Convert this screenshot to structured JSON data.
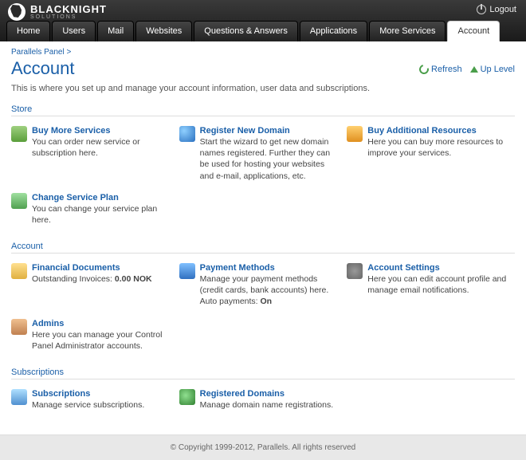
{
  "brand": {
    "name": "BLACKNIGHT",
    "sub": "SOLUTIONS"
  },
  "logout": "Logout",
  "nav": {
    "items": [
      "Home",
      "Users",
      "Mail",
      "Websites",
      "Questions & Answers",
      "Applications",
      "More Services",
      "Account"
    ],
    "active_index": 7
  },
  "breadcrumb": {
    "items": [
      "Parallels Panel"
    ],
    "sep": ">"
  },
  "page": {
    "title": "Account",
    "intro": "This is where you set up and manage your account information, user data and subscriptions."
  },
  "actions": {
    "refresh": "Refresh",
    "uplevel": "Up Level"
  },
  "sections": [
    {
      "title": "Store",
      "cards": [
        {
          "icon": "i-cart",
          "name": "buy-more-services",
          "title": "Buy More Services",
          "desc": "You can order new service or subscription here."
        },
        {
          "icon": "i-globe",
          "name": "register-new-domain",
          "title": "Register New Domain",
          "desc": "Start the wizard to get new domain names registered. Further they can be used for hosting your websites and e-mail, applications, etc."
        },
        {
          "icon": "i-arrows",
          "name": "buy-additional-resources",
          "title": "Buy Additional Resources",
          "desc": "Here you can buy more resources to improve your services."
        },
        {
          "icon": "i-cycle",
          "name": "change-service-plan",
          "title": "Change Service Plan",
          "desc": "You can change your service plan here."
        }
      ]
    },
    {
      "title": "Account",
      "cards": [
        {
          "icon": "i-doc",
          "name": "financial-documents",
          "title": "Financial Documents",
          "desc_pre": "Outstanding Invoices: ",
          "desc_bold": "0.00 NOK"
        },
        {
          "icon": "i-pay",
          "name": "payment-methods",
          "title": "Payment Methods",
          "desc": "Manage your payment methods (credit cards, bank accounts) here.",
          "extra_pre": "Auto payments: ",
          "extra_bold": "On"
        },
        {
          "icon": "i-gear",
          "name": "account-settings",
          "title": "Account Settings",
          "desc": "Here you can edit account profile and manage email notifications."
        },
        {
          "icon": "i-admin",
          "name": "admins",
          "title": "Admins",
          "desc": "Here you can manage your Control Panel Administrator accounts."
        }
      ]
    },
    {
      "title": "Subscriptions",
      "cards": [
        {
          "icon": "i-sub",
          "name": "subscriptions",
          "title": "Subscriptions",
          "desc": "Manage service subscriptions."
        },
        {
          "icon": "i-regd",
          "name": "registered-domains",
          "title": "Registered Domains",
          "desc": "Manage domain name registrations."
        }
      ]
    }
  ],
  "footer": "© Copyright 1999-2012, Parallels. All rights reserved"
}
